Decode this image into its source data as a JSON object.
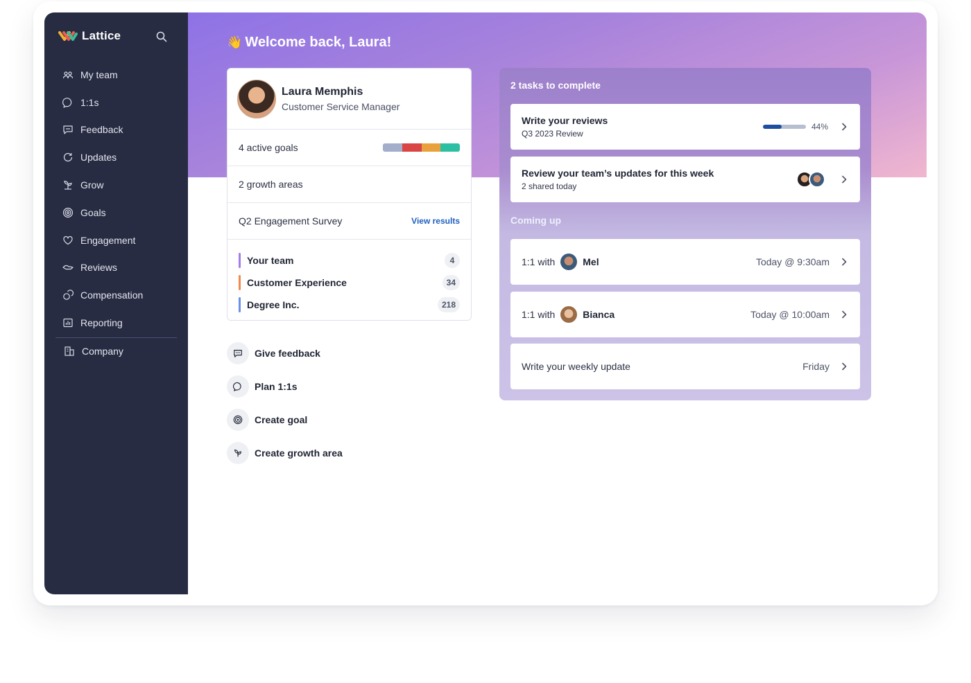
{
  "brand": {
    "name": "Lattice"
  },
  "sidebar": {
    "items": [
      {
        "label": "My team",
        "icon": "people-icon"
      },
      {
        "label": "1:1s",
        "icon": "chat-bubbles-icon"
      },
      {
        "label": "Feedback",
        "icon": "message-square-icon"
      },
      {
        "label": "Updates",
        "icon": "refresh-bubble-icon"
      },
      {
        "label": "Grow",
        "icon": "sprout-icon"
      },
      {
        "label": "Goals",
        "icon": "target-icon"
      },
      {
        "label": "Engagement",
        "icon": "heart-icon"
      },
      {
        "label": "Reviews",
        "icon": "handshake-icon"
      },
      {
        "label": "Compensation",
        "icon": "coins-icon"
      },
      {
        "label": "Reporting",
        "icon": "bar-chart-icon"
      }
    ],
    "company": {
      "label": "Company",
      "icon": "building-icon"
    }
  },
  "main": {
    "welcome": "Welcome back, Laura!",
    "profile": {
      "name": "Laura Memphis",
      "title": "Customer Service Manager",
      "active_goals": "4 active goals",
      "goal_colors": [
        "#a3aecb",
        "#d94545",
        "#e9a23b",
        "#2dbfa3"
      ],
      "growth_areas": "2 growth areas",
      "survey": "Q2 Engagement Survey",
      "survey_link": "View results",
      "teams": [
        {
          "label": "Your team",
          "count": "4",
          "color": "#a67be6"
        },
        {
          "label": "Customer Experience",
          "count": "34",
          "color": "#f08a4b"
        },
        {
          "label": "Degree Inc.",
          "count": "218",
          "color": "#6b8fe8"
        }
      ]
    },
    "actions": [
      {
        "label": "Give feedback",
        "icon": "message-square-icon"
      },
      {
        "label": "Plan 1:1s",
        "icon": "chat-bubble-icon"
      },
      {
        "label": "Create goal",
        "icon": "target-icon"
      },
      {
        "label": "Create growth area",
        "icon": "sprout-icon"
      }
    ],
    "tasks": {
      "heading": "2 tasks to complete",
      "review": {
        "title": "Write your reviews",
        "subtitle": "Q3 2023 Review",
        "progress": 44,
        "progress_label": "44%"
      },
      "updates": {
        "title": "Review your team’s updates for this week",
        "subtitle": "2 shared today"
      }
    },
    "coming_up": {
      "heading": "Coming up",
      "items": [
        {
          "prefix": "1:1 with",
          "name": "Mel",
          "time": "Today @ 9:30am"
        },
        {
          "prefix": "1:1 with",
          "name": "Bianca",
          "time": "Today @ 10:00am"
        }
      ],
      "weekly": {
        "label": "Write your weekly update",
        "time": "Friday"
      }
    }
  }
}
